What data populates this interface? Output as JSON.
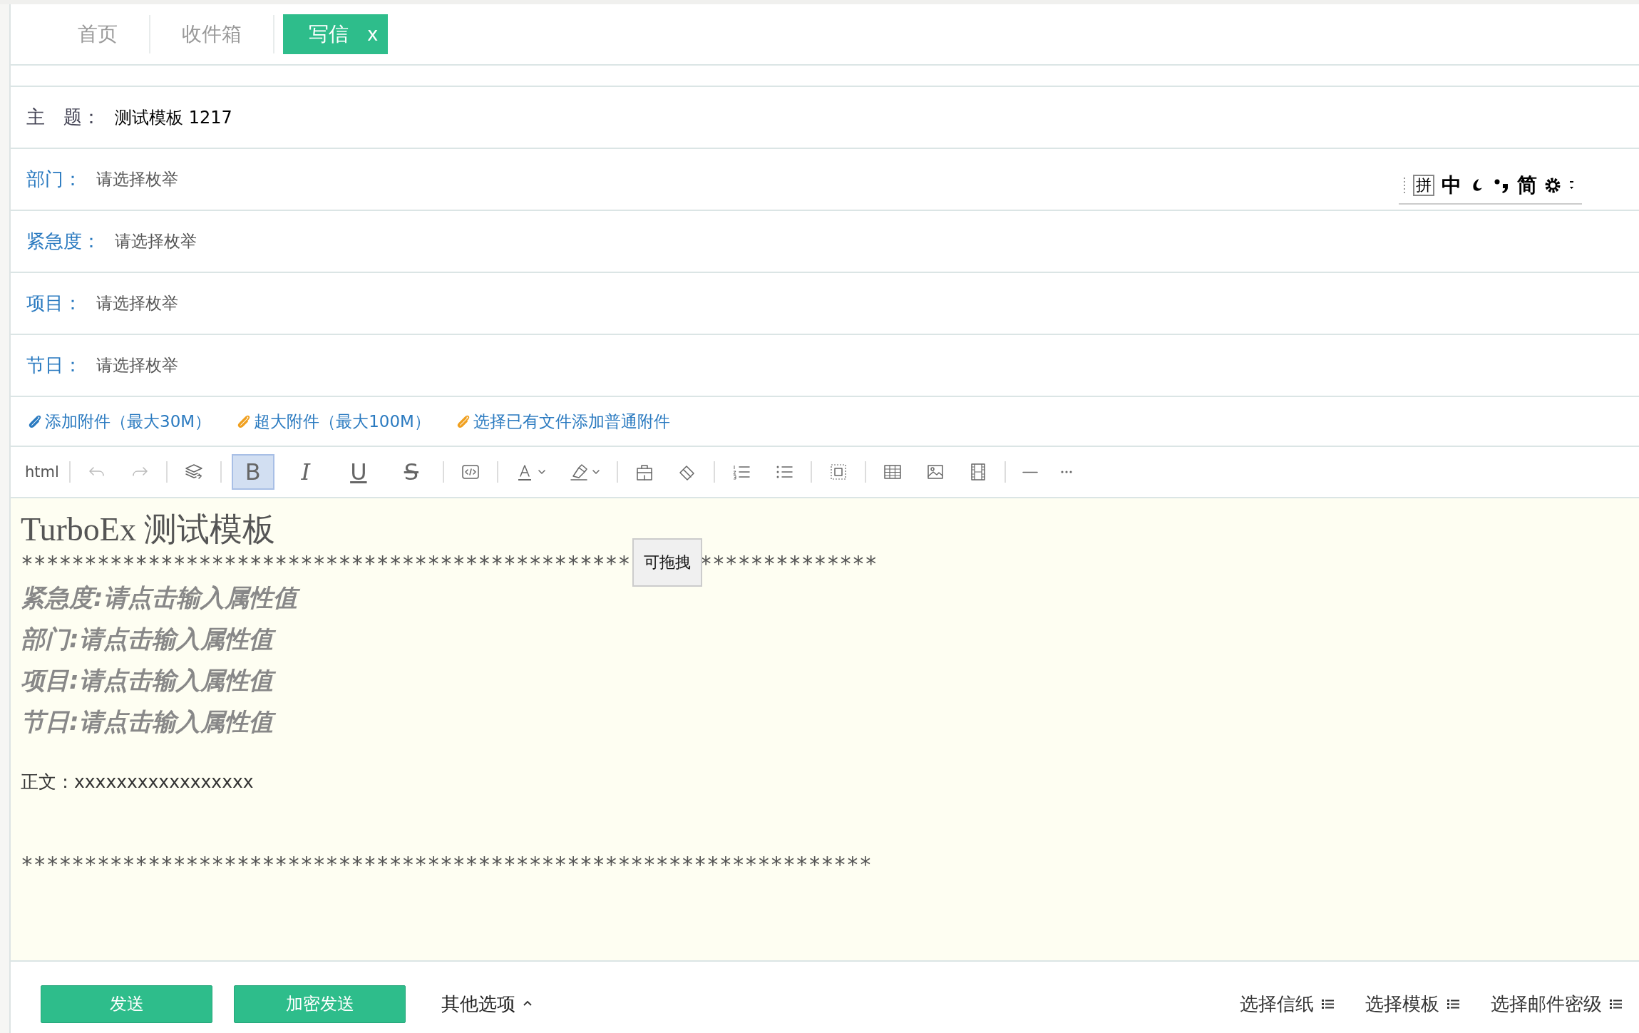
{
  "tabs": [
    {
      "label": "首页",
      "selected": false
    },
    {
      "label": "收件箱",
      "selected": false
    },
    {
      "label": "写信",
      "selected": true,
      "close_label": "x"
    }
  ],
  "fields": [
    {
      "kind": "text",
      "label": "主　题：",
      "value": "测试模板 1217"
    },
    {
      "kind": "select",
      "label": "部门：",
      "placeholder": "请选择枚举"
    },
    {
      "kind": "select",
      "label": "紧急度：",
      "placeholder": "请选择枚举"
    },
    {
      "kind": "select",
      "label": "项目：",
      "placeholder": "请选择枚举"
    },
    {
      "kind": "select",
      "label": "节日：",
      "placeholder": "请选择枚举"
    }
  ],
  "ime_bar": {
    "mode": "拼",
    "language": "中",
    "script": "简"
  },
  "attachments": [
    {
      "label": "添加附件（最大30M）",
      "color": "#2a7ac0"
    },
    {
      "label": "超大附件（最大100M）",
      "color": "#f0a020"
    },
    {
      "label": "选择已有文件添加普通附件",
      "color": "#f0a020"
    }
  ],
  "toolbar": {
    "html_label": "html",
    "format_buttons": [
      {
        "label": "B",
        "selected": true
      },
      {
        "label": "I",
        "selected": false
      },
      {
        "label": "U",
        "selected": false
      },
      {
        "label": "S",
        "selected": false
      }
    ]
  },
  "editor": {
    "title": "TurboEx 测试模板",
    "rule_top_left": "************************************************",
    "rule_top_right": "**************",
    "properties": [
      "紧急度:请点击输入属性值",
      "部门:请点击输入属性值",
      "项目:请点击输入属性值",
      "节日:请点击输入属性值"
    ],
    "body": "正文：xxxxxxxxxxxxxxxxx",
    "rule_bottom": "*******************************************************************",
    "drag_tooltip": "可拖拽"
  },
  "footer": {
    "buttons": [
      "发送",
      "加密发送"
    ],
    "more_options": "其他选项",
    "expanded": true,
    "pickers": [
      "选择信纸",
      "选择模板",
      "选择邮件密级"
    ]
  }
}
